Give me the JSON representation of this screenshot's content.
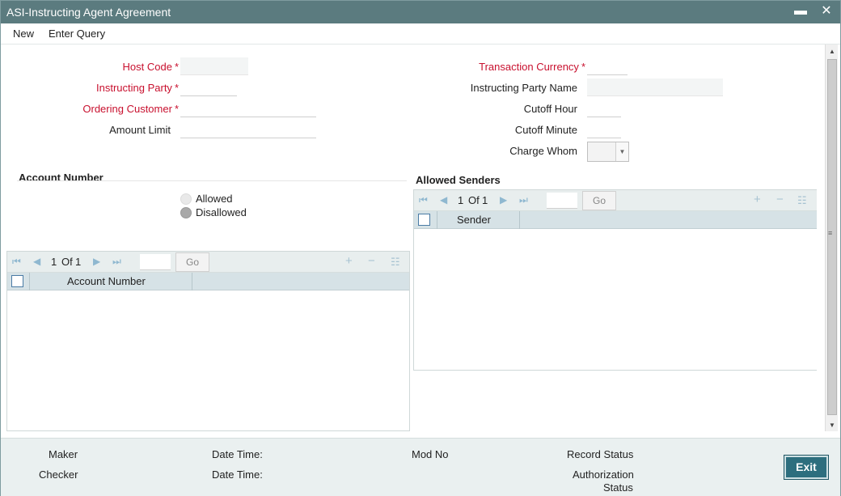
{
  "window": {
    "title": "ASI-Instructing Agent Agreement",
    "minimize_glyph": "▬",
    "close_glyph": "✕"
  },
  "menu": {
    "items": [
      "New",
      "Enter Query"
    ]
  },
  "form": {
    "host_code": {
      "label": "Host Code",
      "value": ""
    },
    "instructing_party": {
      "label": "Instructing Party",
      "value": ""
    },
    "ordering_customer": {
      "label": "Ordering Customer",
      "value": ""
    },
    "amount_limit": {
      "label": "Amount Limit",
      "value": ""
    },
    "transaction_currency": {
      "label": "Transaction Currency",
      "value": ""
    },
    "instructing_party_name": {
      "label": "Instructing Party Name",
      "value": ""
    },
    "cutoff_hour": {
      "label": "Cutoff Hour",
      "value": ""
    },
    "cutoff_minute": {
      "label": "Cutoff Minute",
      "value": ""
    },
    "charge_whom": {
      "label": "Charge Whom",
      "value": ""
    },
    "required_marker": "*"
  },
  "account_number_section": {
    "title": "Account Number",
    "radio_options": [
      {
        "label": "Allowed",
        "checked": false
      },
      {
        "label": "Disallowed",
        "checked": true
      }
    ],
    "grid": {
      "page_current": "1",
      "page_of": "Of",
      "page_total": "1",
      "go_label": "Go",
      "columns": [
        "Account Number"
      ]
    }
  },
  "allowed_senders_section": {
    "title": "Allowed Senders",
    "grid": {
      "page_current": "1",
      "page_of": "Of",
      "page_total": "1",
      "go_label": "Go",
      "columns": [
        "Sender"
      ]
    }
  },
  "footer": {
    "maker": "Maker",
    "checker": "Checker",
    "date_time_1": "Date Time:",
    "date_time_2": "Date Time:",
    "mod_no": "Mod No",
    "record_status": "Record Status",
    "authorization": "Authorization",
    "status": "Status",
    "exit_label": "Exit"
  },
  "icons": {
    "first_page": "first-page-icon",
    "prev_page": "previous-page-icon",
    "next_page": "next-page-icon",
    "last_page": "last-page-icon",
    "add_row": "add-row-icon",
    "delete_row": "delete-row-icon",
    "single_view": "single-view-icon"
  },
  "colors": {
    "titlebar": "#5b7b7f",
    "required": "#c8102e",
    "grid_header": "#d6e2e6",
    "exit_button": "#2d6e7e",
    "footer": "#eaf0f0"
  }
}
